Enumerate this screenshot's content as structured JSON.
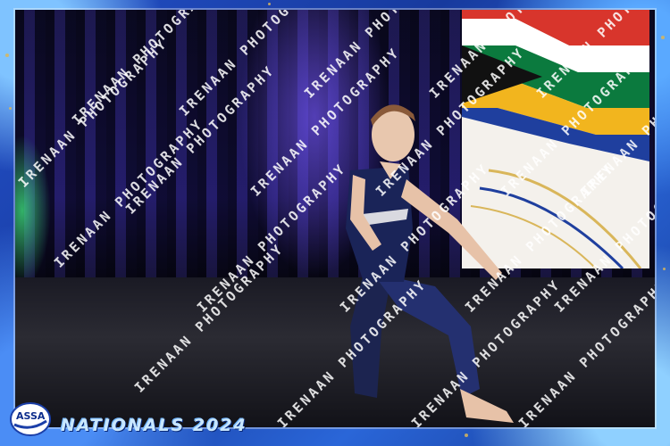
{
  "watermark": {
    "text": "IRENAAN PHOTOGRAPHY"
  },
  "event": {
    "title": "NATIONALS 2024",
    "logo_text": "ASSA"
  },
  "colors": {
    "frame_blue": "#1b3fa8",
    "accent_gold": "#d9b65a",
    "title_text": "#c9e7ff"
  }
}
